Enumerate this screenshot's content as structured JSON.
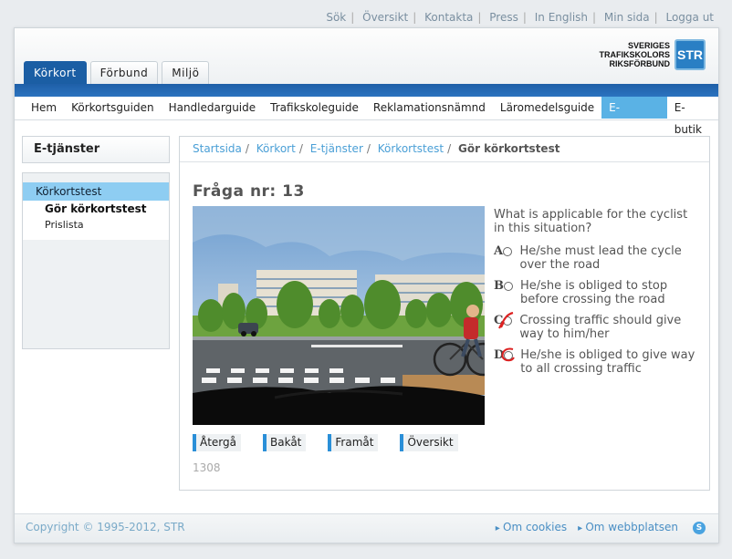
{
  "utility_nav": [
    "Sök",
    "Översikt",
    "Kontakta",
    "Press",
    "In English",
    "Min sida",
    "Logga ut"
  ],
  "brand": {
    "line1": "SVERIGES",
    "line2": "TRAFIKSKOLORS",
    "line3": "RIKSFÖRBUND",
    "badge": "STR"
  },
  "tabs": [
    "Körkort",
    "Förbund",
    "Miljö"
  ],
  "main_nav": [
    "Hem",
    "Körkortsguiden",
    "Handledarguide",
    "Trafikskoleguide",
    "Reklamationsnämnd",
    "Läromedelsguide",
    "E-tjänster",
    "E-butik"
  ],
  "sidebar": {
    "title": "E-tjänster",
    "item": "Körkortstest",
    "sub1": "Gör körkortstest",
    "sub2": "Prislista"
  },
  "breadcrumb": [
    "Startsida",
    "Körkort",
    "E-tjänster",
    "Körkortstest",
    "Gör körkortstest"
  ],
  "question": {
    "title": "Fråga nr: 13",
    "text": "What is applicable for the cyclist in this situation?",
    "options": [
      {
        "letter": "A",
        "text": "He/she must lead the cycle over the road"
      },
      {
        "letter": "B",
        "text": "He/she is obliged to stop before crossing the road"
      },
      {
        "letter": "C",
        "text": "Crossing traffic should give way to him/her"
      },
      {
        "letter": "D",
        "text": "He/she is obliged to give way to all crossing traffic"
      }
    ]
  },
  "buttons": [
    "Återgå",
    "Bakåt",
    "Framåt",
    "Översikt"
  ],
  "code": "1308",
  "footer": {
    "copyright": "Copyright © 1995-2012, STR",
    "links": [
      "Om cookies",
      "Om webbplatsen"
    ]
  },
  "colors": {
    "brand_blue": "#1b5ea4",
    "accent": "#5ab2e5",
    "mark_red": "#d22"
  }
}
